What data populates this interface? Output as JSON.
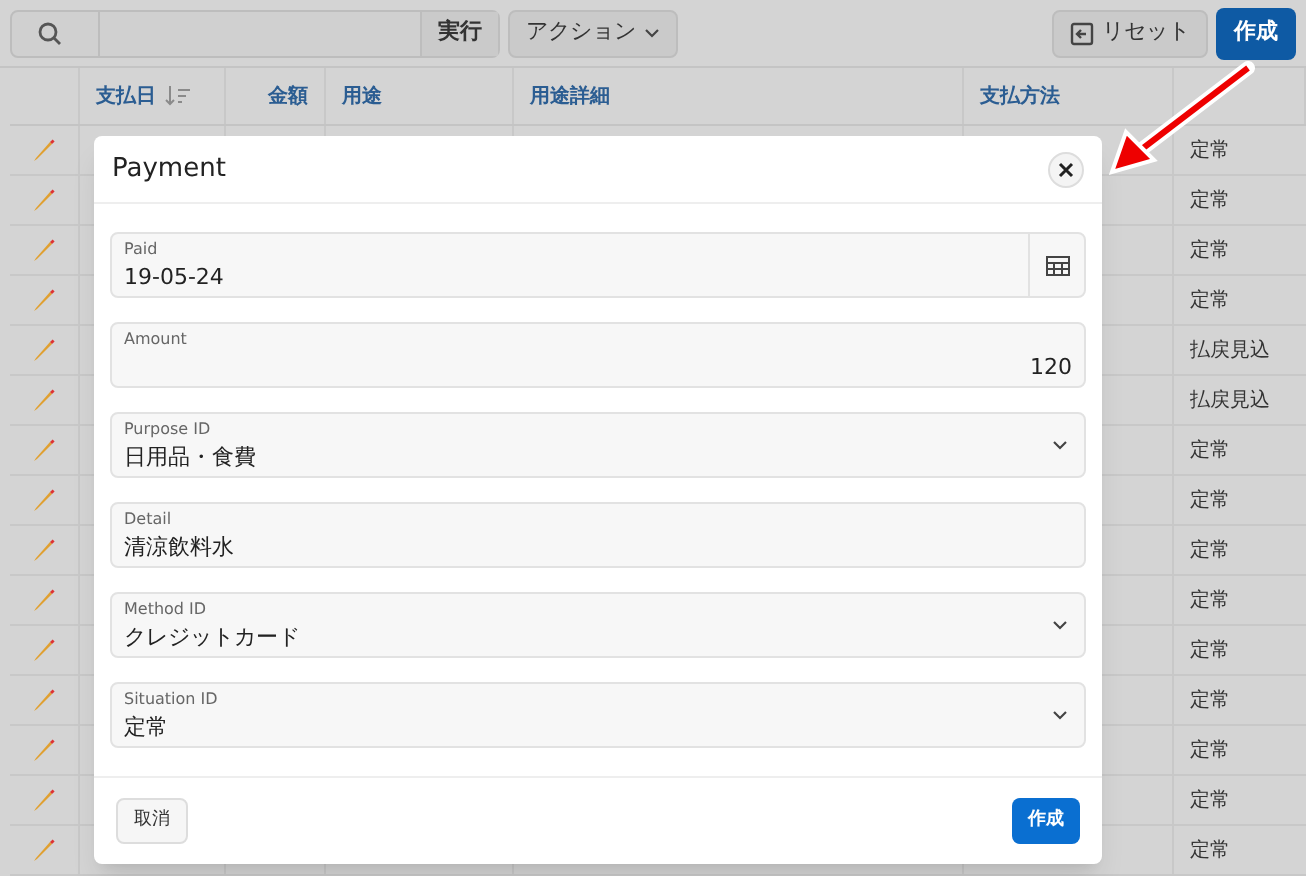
{
  "toolbar": {
    "go_button": "実行",
    "actions_menu": "アクション",
    "reset_button": "リセット",
    "create_button": "作成"
  },
  "table": {
    "columns": [
      {
        "label": "支払日",
        "sorted": true
      },
      {
        "label": "金額",
        "sorted": false
      },
      {
        "label": "用途",
        "sorted": false
      },
      {
        "label": "用途詳細",
        "sorted": false
      },
      {
        "label": "支払方法",
        "sorted": false
      },
      {
        "sorted": false
      }
    ],
    "rows": [
      {
        "column_6": "定常"
      },
      {
        "column_6": "定常"
      },
      {
        "column_6": "定常"
      },
      {
        "column_6": "定常"
      },
      {
        "column_6": "払戻見込"
      },
      {
        "column_6": "払戻見込"
      },
      {
        "column_6": "定常"
      },
      {
        "column_6": "定常"
      },
      {
        "column_6": "定常"
      },
      {
        "column_6": "定常"
      },
      {
        "column_6": "定常"
      },
      {
        "column_6": "定常"
      },
      {
        "column_6": "定常"
      },
      {
        "column_6": "定常"
      },
      {
        "column_6": "定常"
      }
    ]
  },
  "dialog": {
    "title": "Payment",
    "fields": [
      {
        "kind": "date",
        "label": "Paid",
        "value": "19-05-24"
      },
      {
        "kind": "number",
        "label": "Amount",
        "value": "120"
      },
      {
        "kind": "select",
        "label": "Purpose ID",
        "value": "日用品・食費"
      },
      {
        "kind": "text",
        "label": "Detail",
        "value": "清涼飲料水"
      },
      {
        "kind": "select",
        "label": "Method ID",
        "value": "クレジットカード"
      },
      {
        "kind": "select",
        "label": "Situation ID",
        "value": "定常"
      }
    ],
    "cancel_button": "取消",
    "create_button": "作成"
  }
}
